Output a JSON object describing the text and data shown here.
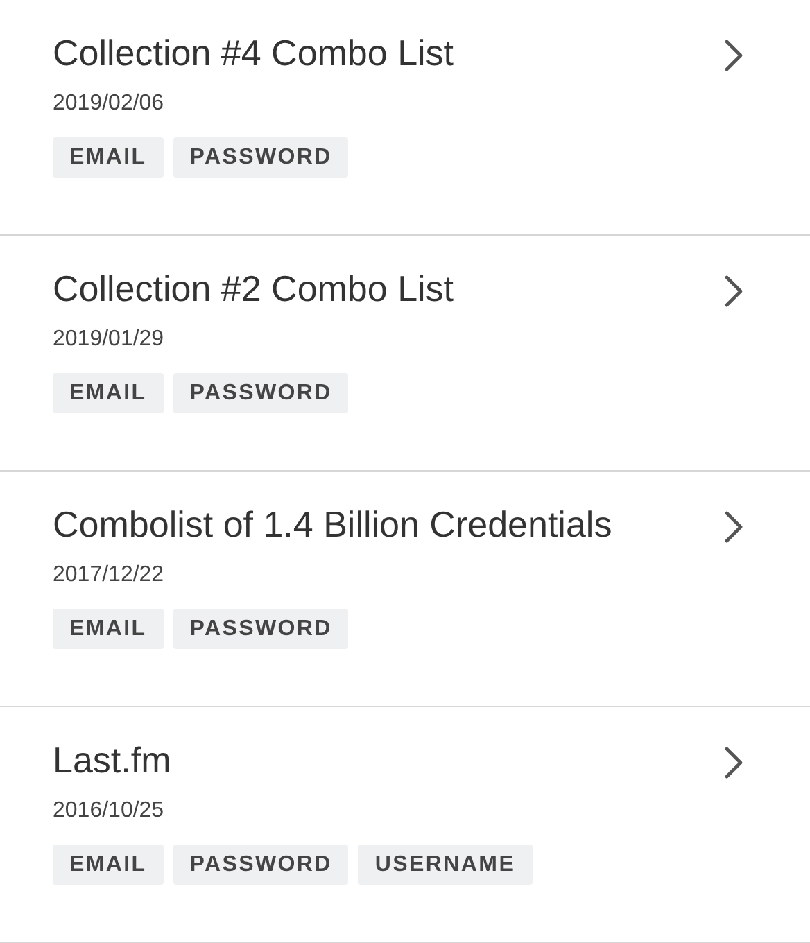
{
  "breaches": [
    {
      "title": "Collection #4 Combo List",
      "date": "2019/02/06",
      "tags": [
        "EMAIL",
        "PASSWORD"
      ]
    },
    {
      "title": "Collection #2 Combo List",
      "date": "2019/01/29",
      "tags": [
        "EMAIL",
        "PASSWORD"
      ]
    },
    {
      "title": "Combolist of 1.4 Billion Credentials",
      "date": "2017/12/22",
      "tags": [
        "EMAIL",
        "PASSWORD"
      ]
    },
    {
      "title": "Last.fm",
      "date": "2016/10/25",
      "tags": [
        "EMAIL",
        "PASSWORD",
        "USERNAME"
      ]
    }
  ]
}
